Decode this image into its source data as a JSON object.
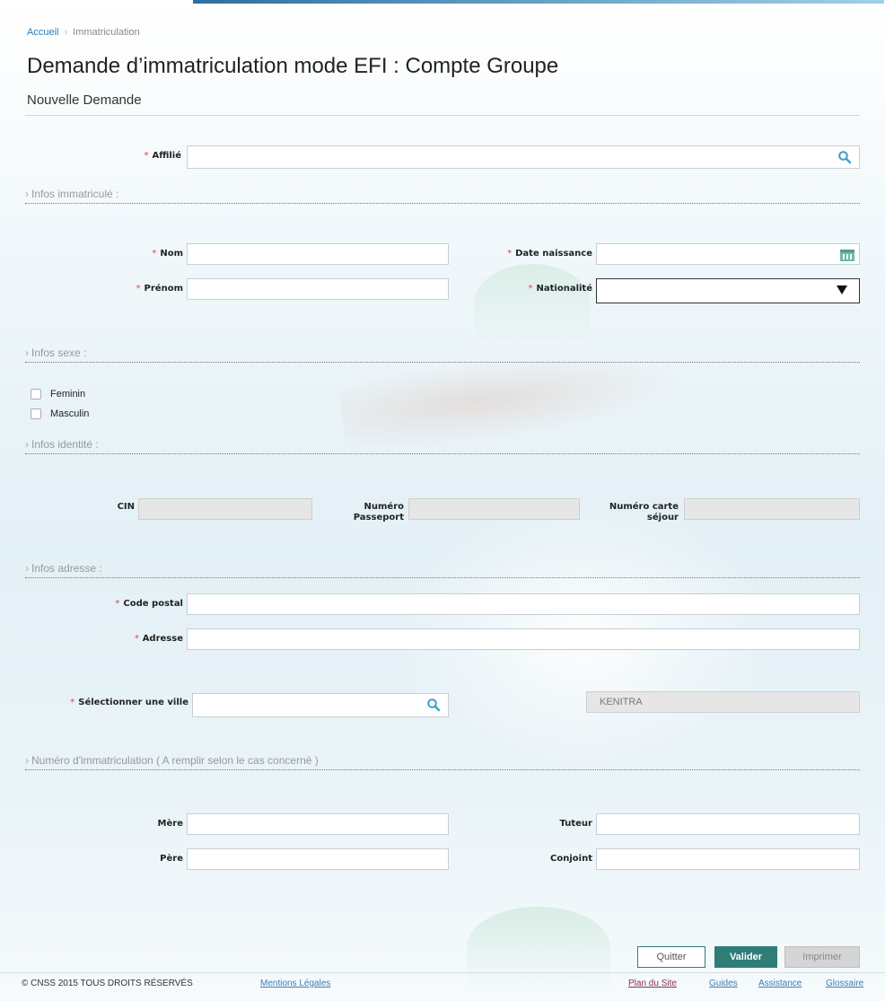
{
  "breadcrumb": {
    "home": "Accueil",
    "current": "Immatriculation"
  },
  "page": {
    "title": "Demande d’immatriculation mode EFI : Compte Groupe",
    "subtitle": "Nouvelle Demande"
  },
  "affilie": {
    "label": "Affilié",
    "value": ""
  },
  "infos_immatricule": {
    "section_title": "Infos immatriculé :",
    "nom": {
      "label": "Nom",
      "value": ""
    },
    "prenom": {
      "label": "Prénom",
      "value": ""
    },
    "date_naissance": {
      "label": "Date naissance",
      "value": ""
    },
    "nationalite": {
      "label": "Nationalité",
      "value": ""
    }
  },
  "infos_sexe": {
    "section_title": "Infos sexe :",
    "options": [
      "Feminin",
      "Masculin"
    ]
  },
  "infos_identite": {
    "section_title": "Infos identité :",
    "cin": {
      "label": "CIN",
      "value": ""
    },
    "passeport": {
      "label_line1": "Numéro",
      "label_line2": "Passeport",
      "value": ""
    },
    "carte_sejour": {
      "label_line1": "Numéro carte",
      "label_line2": "séjour",
      "value": ""
    }
  },
  "infos_adresse": {
    "section_title": "Infos adresse :",
    "code_postal": {
      "label": "Code postal",
      "value": ""
    },
    "adresse": {
      "label": "Adresse",
      "value": ""
    },
    "ville": {
      "label": "Sélectionner une ville",
      "value": "",
      "selected": "KENITRA"
    }
  },
  "numero_immatriculation": {
    "section_title": "Numéro d'immatriculation ( A remplir selon le cas concerné )",
    "mere": {
      "label": "Mère",
      "value": ""
    },
    "pere": {
      "label": "Père",
      "value": ""
    },
    "tuteur": {
      "label": "Tuteur",
      "value": ""
    },
    "conjoint": {
      "label": "Conjoint",
      "value": ""
    }
  },
  "buttons": {
    "quit": "Quitter",
    "validate": "Valider",
    "print": "Imprimer"
  },
  "footer": {
    "copyright": "© CNSS 2015 TOUS DROITS RÉSERVÉS",
    "mentions": "Mentions Légales",
    "links": {
      "plan": "Plan du Site",
      "guides": "Guides",
      "assistance": "Assistance",
      "glossaire": "Glossaire"
    }
  },
  "icons": {
    "search": "search-icon",
    "calendar": "calendar-icon",
    "dropdown": "dropdown-arrow-icon"
  },
  "colors": {
    "accent": "#2e7d78",
    "required": "#e04040",
    "link": "#3d7db5",
    "search_icon": "#3aa0c8"
  }
}
